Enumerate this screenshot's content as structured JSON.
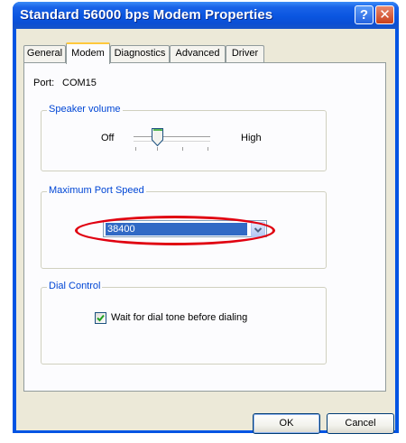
{
  "window": {
    "title": "Standard 56000 bps Modem Properties",
    "help_label": "?",
    "close_label": "✕"
  },
  "tabs": [
    {
      "label": "General",
      "active": false
    },
    {
      "label": "Modem",
      "active": true
    },
    {
      "label": "Diagnostics",
      "active": false
    },
    {
      "label": "Advanced",
      "active": false
    },
    {
      "label": "Driver",
      "active": false
    }
  ],
  "port": {
    "label": "Port:",
    "value": "COM15"
  },
  "speaker_volume": {
    "group_title": "Speaker volume",
    "min_label": "Off",
    "max_label": "High",
    "tick_count": 4,
    "level_position": 1
  },
  "max_port_speed": {
    "group_title": "Maximum Port Speed",
    "selected_value": "38400"
  },
  "dial_control": {
    "group_title": "Dial Control",
    "checkbox_label": "Wait for dial tone before dialing",
    "checked": true
  },
  "buttons": {
    "ok_label": "OK",
    "cancel_label": "Cancel"
  },
  "colors": {
    "titlebar": "#0054e3",
    "dialog_bg": "#ece9d8",
    "group_title": "#0046d5",
    "selection": "#316ac5",
    "annotation": "#e00010"
  }
}
